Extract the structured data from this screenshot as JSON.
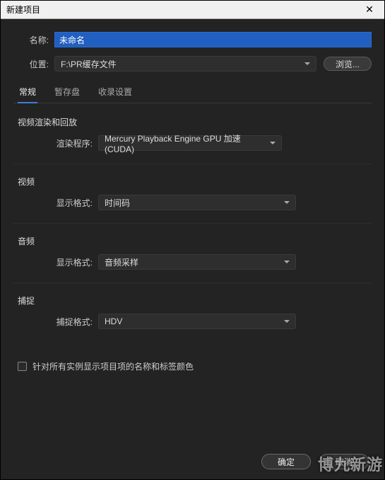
{
  "window": {
    "title": "新建项目",
    "close_glyph": "✕"
  },
  "fields": {
    "name_label": "名称:",
    "name_value": "未命名",
    "location_label": "位置:",
    "location_value": "F:\\PR缓存文件",
    "browse": "浏览..."
  },
  "tabs": {
    "general": "常规",
    "scratch": "暂存盘",
    "ingest": "收录设置"
  },
  "sections": {
    "render": {
      "title": "视频渲染和回放",
      "label": "渲染程序:",
      "value": "Mercury Playback Engine GPU 加速 (CUDA)"
    },
    "video": {
      "title": "视频",
      "label": "显示格式:",
      "value": "时间码"
    },
    "audio": {
      "title": "音频",
      "label": "显示格式:",
      "value": "音频采样"
    },
    "capture": {
      "title": "捕捉",
      "label": "捕捉格式:",
      "value": "HDV"
    }
  },
  "checkbox": {
    "label": "针对所有实例显示项目项的名称和标签颜色",
    "checked": false
  },
  "footer": {
    "ok": "确定",
    "cancel": "取消"
  },
  "watermark": "博九新游"
}
